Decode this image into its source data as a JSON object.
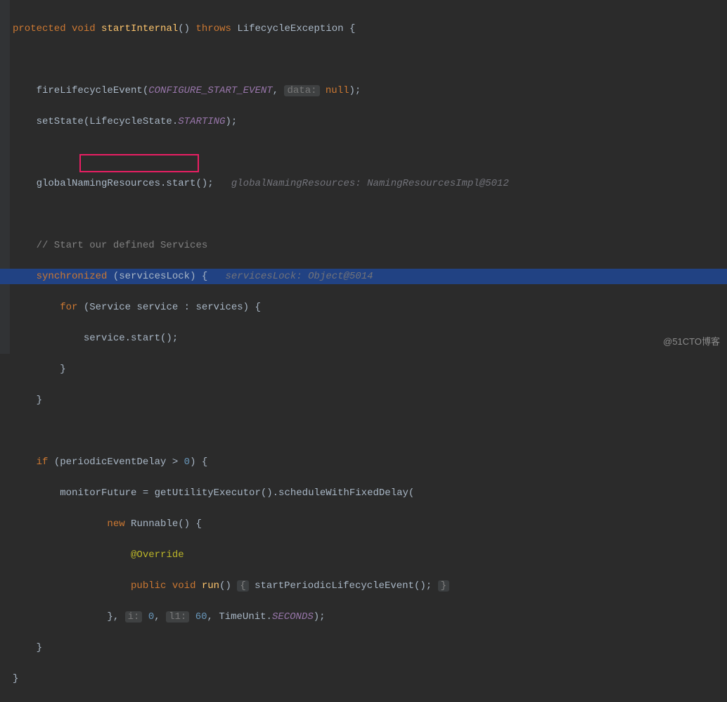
{
  "code": {
    "l1_kw1": "protected",
    "l1_kw2": "void",
    "l1_name": "startInternal",
    "l1_par": "()",
    "l1_kw3": "throws",
    "l1_exc": "LifecycleException {",
    "l2a": "    fireLifecycleEvent(",
    "l2b": "CONFIGURE_START_EVENT",
    "l2c": ", ",
    "l2d_hint": "data:",
    "l2e": " ",
    "l2f": "null",
    "l2g": ");",
    "l3a": "    setState(LifecycleState.",
    "l3b": "STARTING",
    "l3c": ");",
    "l4a": "    globalNamingResources.start();   ",
    "l4b": "globalNamingResources: NamingResourcesImpl@5012",
    "l5": "    // Start our defined Services",
    "l6a": "    ",
    "l6b": "synchronized",
    "l6c": " (",
    "l6d": "servicesLock",
    "l6e": ") {   ",
    "l6f": "servicesLock: Object@5014",
    "l7a": "        ",
    "l7b": "for",
    "l7c": " (Service service : services) {",
    "l8": "            service.start();",
    "l9": "        }",
    "l10": "    }",
    "l11a": "    ",
    "l11b": "if",
    "l11c": " (periodicEventDelay > ",
    "l11d": "0",
    "l11e": ") {",
    "l12": "        monitorFuture = getUtilityExecutor().scheduleWithFixedDelay(",
    "l13a": "                ",
    "l13b": "new",
    "l13c": " Runnable() {",
    "l14a": "                    ",
    "l14b": "@Override",
    "l15a": "                    ",
    "l15b": "public",
    "l15c": " ",
    "l15d": "void",
    "l15e": " ",
    "l15f": "run",
    "l15g": "() ",
    "l15h": "{",
    "l15i": " startPeriodicLifecycleEvent(); ",
    "l15j": "}",
    "l16a": "                }, ",
    "l16b": "i:",
    "l16c": " ",
    "l16d": "0",
    "l16e": ", ",
    "l16f": "l1:",
    "l16g": " ",
    "l16h": "60",
    "l16i": ", TimeUnit.",
    "l16j": "SECONDS",
    "l16k": ");",
    "l17": "    }",
    "l18": "}"
  },
  "watermark": "@51CTO博客"
}
